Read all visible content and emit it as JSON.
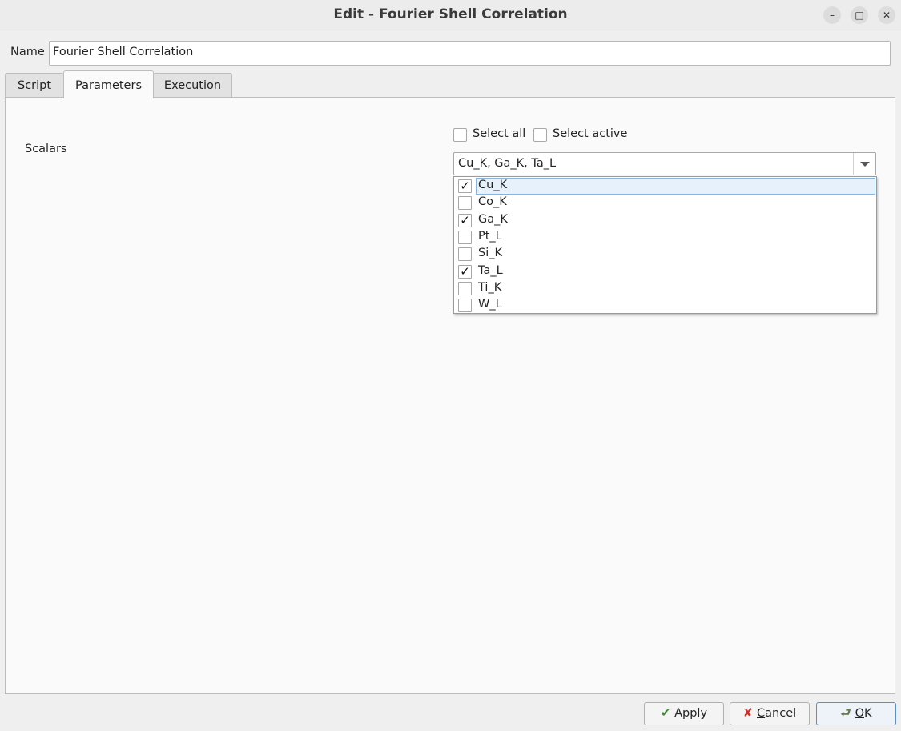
{
  "window": {
    "title": "Edit - Fourier Shell Correlation",
    "controls": {
      "minimize": "–",
      "maximize": "□",
      "close": "✕"
    }
  },
  "name": {
    "label": "Name",
    "value": "Fourier Shell Correlation"
  },
  "tabs": [
    {
      "label": "Script",
      "active": false
    },
    {
      "label": "Parameters",
      "active": true
    },
    {
      "label": "Execution",
      "active": false
    }
  ],
  "parameters": {
    "scalars_label": "Scalars",
    "select_all": {
      "label": "Select all",
      "checked": false
    },
    "select_active": {
      "label": "Select active",
      "checked": false
    },
    "combo_value": "Cu_K, Ga_K, Ta_L",
    "options": [
      {
        "label": "Cu_K",
        "checked": true,
        "highlighted": true
      },
      {
        "label": "Co_K",
        "checked": false,
        "highlighted": false
      },
      {
        "label": "Ga_K",
        "checked": true,
        "highlighted": false
      },
      {
        "label": "Pt_L",
        "checked": false,
        "highlighted": false
      },
      {
        "label": "Si_K",
        "checked": false,
        "highlighted": false
      },
      {
        "label": "Ta_L",
        "checked": true,
        "highlighted": false
      },
      {
        "label": "Ti_K",
        "checked": false,
        "highlighted": false
      },
      {
        "label": "W_L",
        "checked": false,
        "highlighted": false
      }
    ]
  },
  "buttons": {
    "apply": {
      "label": "Apply",
      "icon": "checkmark-icon"
    },
    "cancel": {
      "prefix": "C",
      "rest": "ancel",
      "icon": "cross-icon"
    },
    "ok": {
      "prefix": "O",
      "rest": "K",
      "icon": "return-arrow-icon"
    }
  },
  "colors": {
    "highlight_bg": "#e6f1fb",
    "highlight_border": "#86b6e0",
    "default_button_border": "#5c8fc4"
  }
}
